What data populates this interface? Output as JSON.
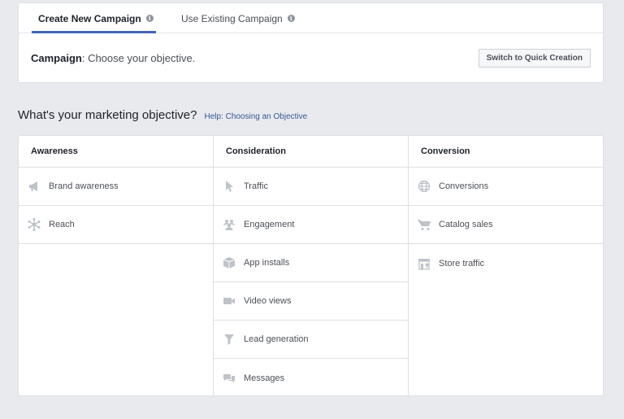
{
  "tabs": {
    "create": "Create New Campaign",
    "existing": "Use Existing Campaign",
    "info_glyph": "i"
  },
  "campaign": {
    "label": "Campaign",
    "text": ": Choose your objective."
  },
  "quick_creation_button": "Switch to Quick Creation",
  "objective_heading": "What's your marketing objective?",
  "help_link": "Help: Choosing an Objective",
  "columns": [
    {
      "title": "Awareness",
      "items": [
        {
          "label": "Brand awareness",
          "icon": "megaphone-icon"
        },
        {
          "label": "Reach",
          "icon": "reach-icon"
        }
      ]
    },
    {
      "title": "Consideration",
      "items": [
        {
          "label": "Traffic",
          "icon": "cursor-icon"
        },
        {
          "label": "Engagement",
          "icon": "people-icon"
        },
        {
          "label": "App installs",
          "icon": "box-icon"
        },
        {
          "label": "Video views",
          "icon": "video-camera-icon"
        },
        {
          "label": "Lead generation",
          "icon": "funnel-icon"
        },
        {
          "label": "Messages",
          "icon": "chat-bubbles-icon"
        }
      ]
    },
    {
      "title": "Conversion",
      "items": [
        {
          "label": "Conversions",
          "icon": "globe-icon"
        },
        {
          "label": "Catalog sales",
          "icon": "shopping-cart-icon"
        },
        {
          "label": "Store traffic",
          "icon": "store-icon"
        }
      ]
    }
  ],
  "colors": {
    "accent": "#4267b2",
    "link": "#365899",
    "icon": "#bec3c9",
    "background": "#e9eaed"
  }
}
